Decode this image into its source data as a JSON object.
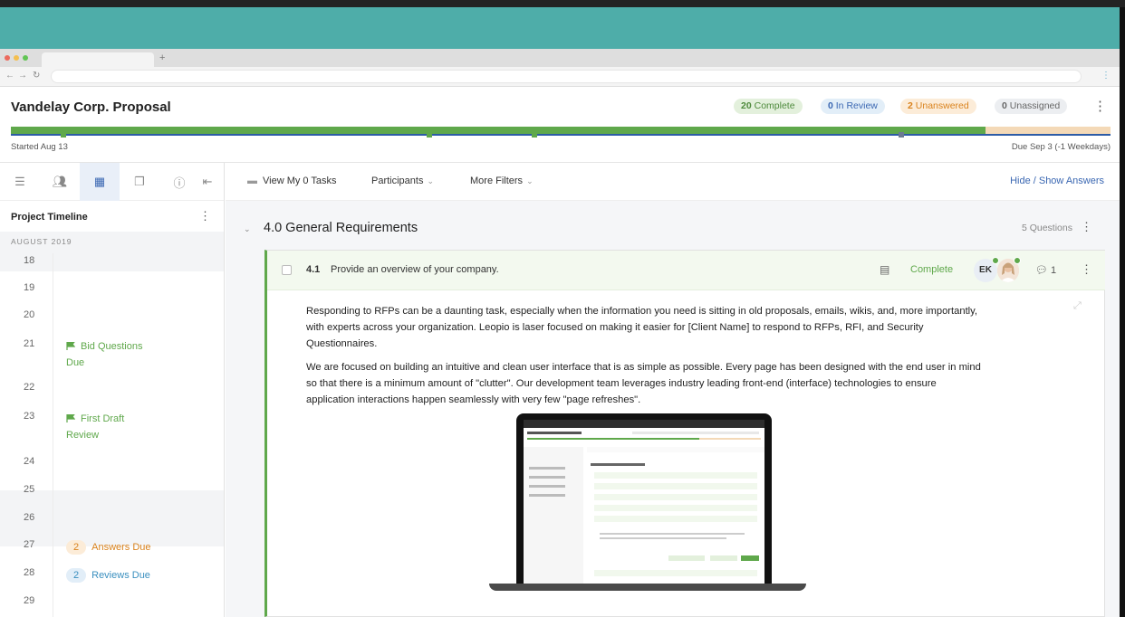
{
  "app": {
    "title": "Vandelay Corp. Proposal",
    "status_pills": [
      {
        "count": "20",
        "label": "Complete"
      },
      {
        "count": "0",
        "label": "In Review"
      },
      {
        "count": "2",
        "label": "Unanswered"
      },
      {
        "count": "0",
        "label": "Unassigned"
      }
    ],
    "start_label": "Started Aug 13",
    "due_label": "Due Sep 3 (-1 Weekdays)",
    "progress_complete_fraction": 0.886
  },
  "colors": {
    "accent_green": "#5fa84b",
    "accent_blue": "#3a67b2",
    "warning_orange": "#e08a1e",
    "teal": "#4eada9"
  },
  "sidebar": {
    "tools": [
      "list-icon",
      "participants-icon",
      "calendar-icon",
      "copy-icon",
      "info-icon",
      "collapse-icon"
    ],
    "title": "Project Timeline",
    "month": "AUGUST 2019",
    "days": [
      "18",
      "19",
      "20",
      "21",
      "22",
      "23",
      "24",
      "25",
      "26",
      "27",
      "28",
      "29"
    ],
    "events": {
      "bid_questions": "Bid Questions Due",
      "bid_questions_line1": "Bid Questions",
      "bid_questions_line2": "Due",
      "first_draft_line1": "First Draft",
      "first_draft_line2": "Review",
      "answers_count": "2",
      "answers_label": "Answers Due",
      "reviews_count": "2",
      "reviews_label": "Reviews Due"
    }
  },
  "filters": {
    "my_tasks": "View My 0 Tasks",
    "participants": "Participants",
    "more_filters": "More Filters",
    "hide_show": "Hide / Show Answers"
  },
  "section": {
    "title": "4.0 General Requirements",
    "question_count": "5 Questions"
  },
  "question": {
    "number": "4.1",
    "text": "Provide an overview of your company.",
    "status": "Complete",
    "assignee_initials": "EK",
    "comment_count": "1",
    "answer_p1": "Responding to RFPs can be a daunting task, especially when the information you need is sitting in old proposals, emails, wikis, and, more importantly, with experts across your organization. Leopio is laser focused on making it easier for [Client Name] to respond to RFPs, RFI, and Security Questionnaires.",
    "answer_p2": "We are focused on building an intuitive and clean user interface that is as simple as possible. Every page has been designed with the end user in mind so that there is a minimum amount of \"clutter\". Our development team leverages industry leading front-end (interface) technologies to ensure application interactions happen seamlessly with very few \"page refreshes\"."
  }
}
